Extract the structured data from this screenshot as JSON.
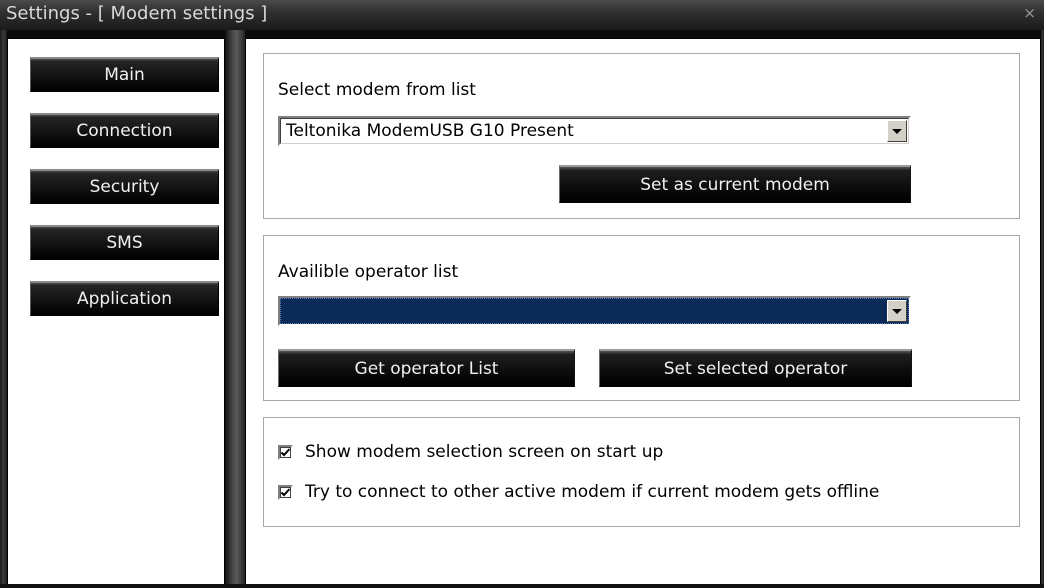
{
  "window": {
    "title": "Settings - [ Modem settings ]",
    "close_glyph": "×"
  },
  "sidebar": {
    "items": [
      {
        "label": "Main"
      },
      {
        "label": "Connection"
      },
      {
        "label": "Security"
      },
      {
        "label": "SMS"
      },
      {
        "label": "Application"
      }
    ]
  },
  "modem_group": {
    "label": "Select modem from list",
    "selected_modem": "Teltonika ModemUSB G10  Present",
    "set_button": "Set as current modem"
  },
  "operator_group": {
    "label": "Availible operator list",
    "selected_operator": "",
    "get_button": "Get operator List",
    "set_button": "Set selected operator"
  },
  "options_group": {
    "options": [
      {
        "label": "Show modem selection screen on start up",
        "checked": true
      },
      {
        "label": "Try to connect to other active modem if current modem gets offline",
        "checked": true
      }
    ]
  },
  "colors": {
    "operator_select_bg": "#0b2a58",
    "button_bg": "#000000",
    "button_text": "#f0f0f0"
  }
}
